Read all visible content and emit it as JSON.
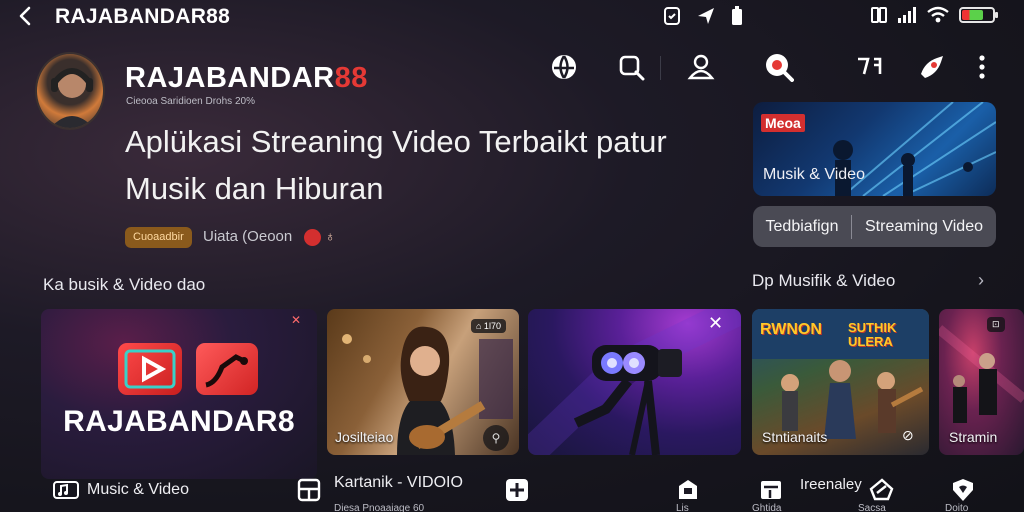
{
  "status_bar": {
    "app_name": "RAJABANDAR88",
    "icons": [
      "back-arrow-icon",
      "screenshot-icon",
      "send-icon",
      "battery-small-icon",
      "signal-bars-icon",
      "wifi-icon",
      "battery-icon"
    ]
  },
  "header": {
    "brand_prefix": "RAJABANDAR",
    "brand_suffix": "88",
    "brand_subtitle": "Cieooa Saridioen Drohs 20%",
    "headline_line1": "Aplükasi Streaning Video Terbaikt patur",
    "headline_line2": "Musik dan Hiburan",
    "badge": "Cuoaadbir",
    "meta": "Uiata (Oeoon"
  },
  "toolbar": {
    "icons": [
      "globe-icon",
      "search-icon",
      "profile-icon",
      "zoom-search-icon",
      "translate-icon",
      "share-icon",
      "more-icon"
    ]
  },
  "promo": {
    "badge": "Meoa",
    "label": "Musik & Video"
  },
  "segments": {
    "left": "Tedbiafign",
    "right": "Streaming Video"
  },
  "sections": {
    "left_title": "Ka busik & Video dao",
    "right_title": "Dp Musifik & Video",
    "chevron": "›"
  },
  "cards": {
    "c1": {
      "brand": "RAJABANDAR8",
      "corner": "✕"
    },
    "c2": {
      "chip": "⌂ 1l70",
      "caption": "Josilteiao"
    },
    "c3": {
      "close": "✕"
    },
    "c4": {
      "poster_left": "RWNON",
      "poster_right": "SUTHIK ULERA",
      "caption": "Stntianaits"
    },
    "c5": {
      "chip": "⊡",
      "caption": "Stramin"
    }
  },
  "bottom": {
    "item1": "Music & Video",
    "item2": "Kartanik - VIDOIO",
    "item3": "Ireenaley",
    "sub2": "Diesa Pnoaaiage 60",
    "sub3": "Lis",
    "sub4": "Ghtida",
    "sub5": "Sacsa",
    "sub6": "Doito"
  }
}
